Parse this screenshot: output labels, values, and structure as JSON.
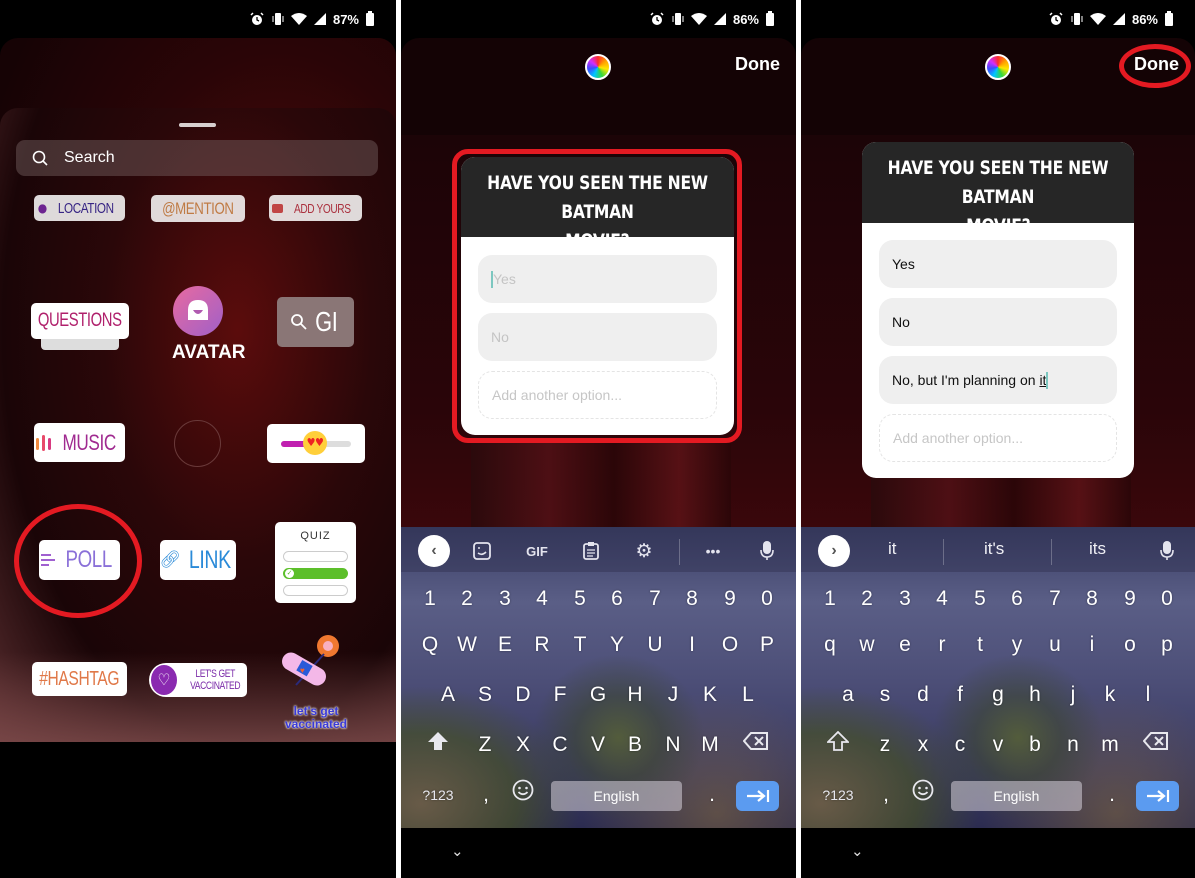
{
  "panels": [
    {
      "status": {
        "battery": "87%"
      },
      "sticker_tray": {
        "search_placeholder": "Search",
        "stickers": {
          "location": "LOCATION",
          "mention": "@MENTION",
          "add_yours": "ADD YOURS",
          "questions": "QUESTIONS",
          "avatar": "AVATAR",
          "gif": "GI",
          "music": "MUSIC",
          "poll": "POLL",
          "link": "LINK",
          "quiz": "QUIZ",
          "hashtag": "#HASHTAG",
          "vaccinated_badge_line1": "LET'S GET",
          "vaccinated_badge_line2": "VACCINATED",
          "vaccinated_art_line1": "let's get",
          "vaccinated_art_line2": "vaccinated"
        },
        "highlighted": "poll"
      }
    },
    {
      "status": {
        "battery": "86%"
      },
      "toolbar": {
        "done_label": "Done"
      },
      "poll": {
        "question_line1": "HAVE YOU SEEN THE NEW BATMAN",
        "question_line2": "MOVIE?",
        "options": [
          {
            "placeholder": "Yes",
            "value": ""
          },
          {
            "placeholder": "No",
            "value": ""
          }
        ],
        "add_option_placeholder": "Add another option..."
      },
      "keyboard": {
        "toolbar": [
          "sticker",
          "GIF",
          "clipboard",
          "settings",
          "more",
          "mic"
        ],
        "gif_label": "GIF",
        "number_row": [
          "1",
          "2",
          "3",
          "4",
          "5",
          "6",
          "7",
          "8",
          "9",
          "0"
        ],
        "row1": [
          "Q",
          "W",
          "E",
          "R",
          "T",
          "Y",
          "U",
          "I",
          "O",
          "P"
        ],
        "row2": [
          "A",
          "S",
          "D",
          "F",
          "G",
          "H",
          "J",
          "K",
          "L"
        ],
        "row3": [
          "Z",
          "X",
          "C",
          "V",
          "B",
          "N",
          "M"
        ],
        "symbols_label": "?123",
        "comma": ",",
        "period": ".",
        "space_label": "English"
      }
    },
    {
      "status": {
        "battery": "86%"
      },
      "toolbar": {
        "done_label": "Done"
      },
      "poll": {
        "question_line1": "HAVE YOU SEEN THE NEW BATMAN",
        "question_line2": "MOVIE?",
        "options": [
          {
            "value": "Yes"
          },
          {
            "value": "No"
          },
          {
            "value_prefix": "No, but I'm planning on ",
            "value_underlined": "it"
          }
        ],
        "add_option_placeholder": "Add another option..."
      },
      "keyboard": {
        "suggestions": [
          "it",
          "it's",
          "its"
        ],
        "number_row": [
          "1",
          "2",
          "3",
          "4",
          "5",
          "6",
          "7",
          "8",
          "9",
          "0"
        ],
        "row1": [
          "q",
          "w",
          "e",
          "r",
          "t",
          "y",
          "u",
          "i",
          "o",
          "p"
        ],
        "row2": [
          "a",
          "s",
          "d",
          "f",
          "g",
          "h",
          "j",
          "k",
          "l"
        ],
        "row3": [
          "z",
          "x",
          "c",
          "v",
          "b",
          "n",
          "m"
        ],
        "symbols_label": "?123",
        "comma": ",",
        "period": ".",
        "space_label": "English"
      }
    }
  ],
  "colors": {
    "highlight_red": "#e41a22",
    "poll_header": "#262626",
    "enter_key": "#5b9bf0"
  }
}
